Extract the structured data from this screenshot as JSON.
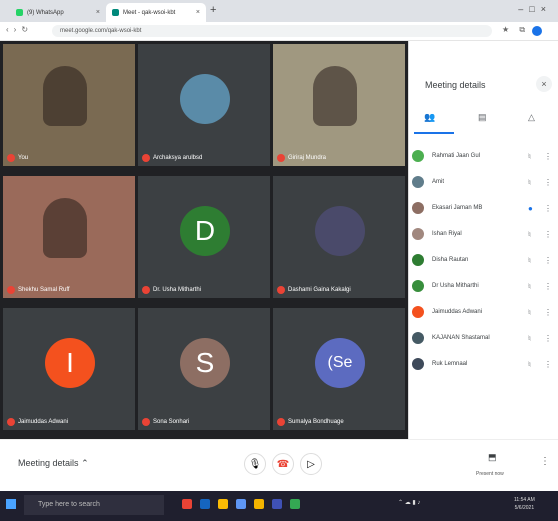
{
  "browser": {
    "tabs": [
      {
        "label": "(9) WhatsApp"
      },
      {
        "label": "Meet - qak-wsoi-kbt"
      }
    ],
    "url": "meet.google.com/qak-wsoi-kbt"
  },
  "tiles": [
    {
      "name": "You",
      "type": "video",
      "bg": "#7a6a52"
    },
    {
      "name": "Archaksya arulbsd",
      "type": "photo",
      "bg": "#5a8ba8"
    },
    {
      "name": "Giriraj Mundra",
      "type": "video",
      "bg": "#a09880"
    },
    {
      "name": "Shekhu Samal Ruff",
      "type": "video",
      "bg": "#9a6a5a"
    },
    {
      "name": "Dr. Usha Mitharthi",
      "type": "letter",
      "letter": "D",
      "color": "#2e7d32"
    },
    {
      "name": "Dashami Gaina Kakalgi",
      "type": "photo",
      "bg": "#4a4a6a"
    },
    {
      "name": "Jaimuddas Adwani",
      "type": "letter",
      "letter": "I",
      "color": "#f4511e"
    },
    {
      "name": "Sona Sonhari",
      "type": "letter",
      "letter": "S",
      "color": "#8d6e63"
    },
    {
      "name": "Sumalya Bondhuage",
      "type": "letter",
      "letter": "(Se",
      "color": "#5c6bc0"
    }
  ],
  "sidebar": {
    "title": "Meeting details",
    "participants": [
      {
        "name": "Rahmati Jaan Gul",
        "color": "#4caf50"
      },
      {
        "name": "Amit",
        "color": "#607d8b"
      },
      {
        "name": "Ekasari Jaman MB",
        "color": "#8d6e63",
        "speaking": true
      },
      {
        "name": "Ishan Riyal",
        "color": "#a1887f"
      },
      {
        "name": "Disha Rautan",
        "color": "#2e7d32"
      },
      {
        "name": "Dr Usha Mitharthi",
        "color": "#388e3c"
      },
      {
        "name": "Jaimuddas Adwani",
        "color": "#f4511e"
      },
      {
        "name": "KAJANAN Shastamal",
        "color": "#455a64"
      },
      {
        "name": "Ruk Lemnaal",
        "color": "#3e4a5a"
      }
    ]
  },
  "bottom": {
    "details_label": "Meeting details",
    "present_label": "Present now"
  },
  "taskbar": {
    "search": "Type here to search",
    "time": "11:54 AM",
    "date": "5/6/2021"
  }
}
